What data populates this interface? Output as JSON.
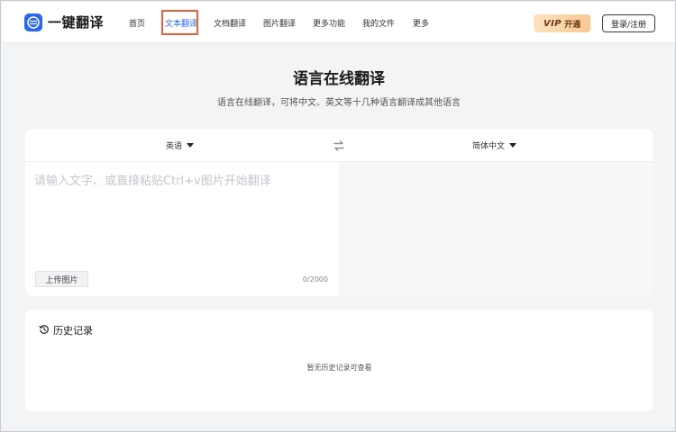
{
  "header": {
    "logo_text": "一键翻译",
    "nav": [
      {
        "label": "首页"
      },
      {
        "label": "文本翻译",
        "active": true
      },
      {
        "label": "文档翻译"
      },
      {
        "label": "图片翻译"
      },
      {
        "label": "更多功能"
      },
      {
        "label": "我的文件"
      },
      {
        "label": "更多"
      }
    ],
    "vip_badge": "VIP",
    "vip_label": "开通",
    "login_label": "登录/注册"
  },
  "hero": {
    "title": "语言在线翻译",
    "subtitle": "语言在线翻译，可将中文、英文等十几种语言翻译成其他语言"
  },
  "translator": {
    "source_lang": "英语",
    "target_lang": "简体中文",
    "input_placeholder": "请输入文字、或直接粘贴Ctrl+v图片开始翻译",
    "input_value": "",
    "upload_label": "上传图片",
    "char_count": "0/2000"
  },
  "history": {
    "title": "历史记录",
    "empty_text": "暂无历史记录可查看"
  },
  "colors": {
    "accent": "#2a67f5",
    "highlight_border": "#e8603c",
    "page_bg": "#f3f4f6"
  },
  "icons": {
    "logo": "translate-logo-icon",
    "swap": "swap-arrows-icon",
    "history": "history-clock-icon"
  }
}
